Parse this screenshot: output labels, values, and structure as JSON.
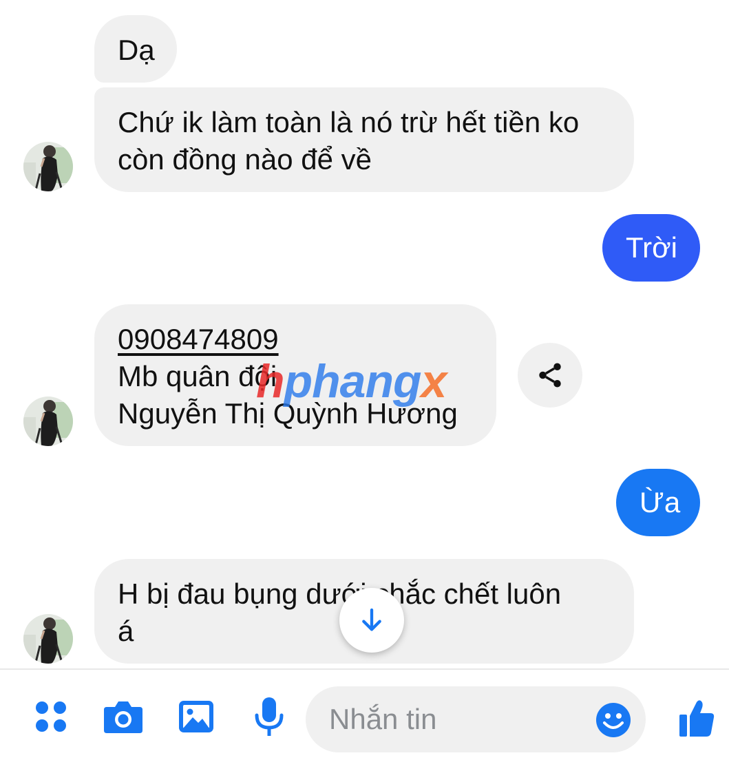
{
  "accent_color": "#1878f3",
  "messages": [
    {
      "side": "incoming",
      "lines": [
        "Dạ"
      ]
    },
    {
      "side": "incoming",
      "lines": [
        "Chứ ik làm toàn là nó trừ hết tiền ko",
        "còn đồng nào để về"
      ]
    },
    {
      "side": "outgoing",
      "lines": [
        "Trời"
      ]
    },
    {
      "side": "incoming",
      "lines": [
        "0908474809",
        "Mb quân đội",
        "Nguyễn Thị Quỳnh Hương"
      ]
    },
    {
      "side": "outgoing",
      "lines": [
        "Ừa"
      ]
    },
    {
      "side": "incoming",
      "lines": [
        "H bị đau bụng dưới chắc chết luôn",
        "á"
      ]
    }
  ],
  "watermark": {
    "first": "h",
    "middle": "phang",
    "last": "x"
  },
  "icons": {
    "share": "share-icon",
    "scroll_down": "arrow-down-icon",
    "apps": "four-dots-icon",
    "camera": "camera-icon",
    "gallery": "image-icon",
    "voice": "microphone-icon",
    "emoji": "smiley-icon",
    "like": "thumbs-up-icon"
  },
  "composer": {
    "placeholder": "Nhắn tin"
  }
}
